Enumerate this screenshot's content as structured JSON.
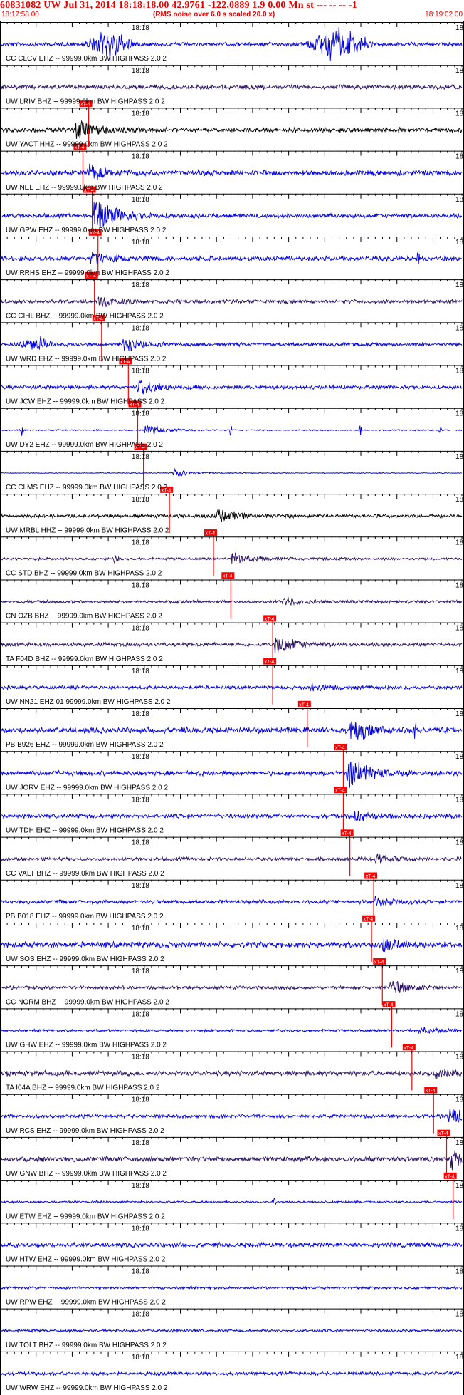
{
  "header": {
    "title": "60831082 UW Jul 31, 2014 18:18:18.00   42.9761 -122.0889  1.9 0.00 Mn st --- -- --   -1",
    "start_time": "18:17:58.00",
    "note": "(RMS noise over 6.0 s scaled 20.0 x)",
    "end_time": "18:19:02.00"
  },
  "colors": {
    "header_text": "#e60000",
    "trace_blue": "#0000dd",
    "trace_navy": "#2a1263",
    "trace_black": "#000000",
    "pick": "#ff0000",
    "grid": "#000000"
  },
  "chart_data": {
    "type": "seismogram",
    "time_window": [
      "18:17:58.00",
      "18:19:02.00"
    ],
    "time_start_s": 0,
    "time_end_s": 64,
    "origin_s": 20,
    "major_tick_label": "18:18",
    "right_edge_label": "18",
    "pick_label": "xT-4",
    "minor_tick_s": 1,
    "major_tick_s": 5,
    "traces": [
      {
        "label": "CC CLCV EHZ -- 99999.0km BW  HIGHPASS  2.0  2",
        "color": "blue",
        "pick_s": null,
        "noise": 0.45,
        "onset_s": null,
        "burst_amp": 0,
        "bursts": [
          {
            "t": 15,
            "d": 4,
            "a": 3.5
          },
          {
            "t": 47,
            "d": 5,
            "a": 4
          }
        ]
      },
      {
        "label": "UW LRIV BHZ -- 99999.0km BW  HIGHPASS  2.0  2",
        "color": "navy",
        "pick_s": 11,
        "noise": 0.5,
        "onset_s": null,
        "burst_amp": 0,
        "bursts": []
      },
      {
        "label": "UW YACT HHZ -- 99999.0km BW  HIGHPASS  2.0  2",
        "color": "black",
        "pick_s": 10.2,
        "noise": 0.55,
        "onset_s": 10.5,
        "burst_amp": 3,
        "bursts": []
      },
      {
        "label": "UW NEL EHZ -- 99999.0km BW  HIGHPASS  2.0  2",
        "color": "blue",
        "pick_s": 11.5,
        "noise": 0.6,
        "onset_s": 12,
        "burst_amp": 2.2,
        "bursts": []
      },
      {
        "label": "UW GPW EHZ -- 99999.0km BW  HIGHPASS  2.0  2",
        "color": "blue",
        "pick_s": 12.3,
        "noise": 0.5,
        "onset_s": 13,
        "burst_amp": 5.5,
        "bursts": []
      },
      {
        "label": "UW RRHS EHZ -- 99999.0km BW  HIGHPASS  2.0  2",
        "color": "blue",
        "pick_s": 11.8,
        "noise": 0.55,
        "onset_s": 12.5,
        "burst_amp": 1.8,
        "bursts": [
          {
            "t": 58,
            "d": 0.3,
            "a": 3
          }
        ]
      },
      {
        "label": "CC CIHL BHZ -- 99999.0km BW  HIGHPASS  2.0  2",
        "color": "navy",
        "pick_s": 12.8,
        "noise": 0.45,
        "onset_s": 13.5,
        "burst_amp": 1.5,
        "bursts": []
      },
      {
        "label": "UW WRD EHZ -- 99999.0km BW  HIGHPASS  2.0  2",
        "color": "blue",
        "pick_s": 16.5,
        "noise": 0.4,
        "onset_s": 17,
        "burst_amp": 2,
        "bursts": [
          {
            "t": 5,
            "d": 3,
            "a": 1.8
          }
        ]
      },
      {
        "label": "UW JCW EHZ -- 99999.0km BW  HIGHPASS  2.0  2",
        "color": "blue",
        "pick_s": 17.8,
        "noise": 0.45,
        "onset_s": 19,
        "burst_amp": 2.5,
        "bursts": []
      },
      {
        "label": "UW DY2 EHZ -- 99999.0km BW  HIGHPASS  2.0  2",
        "color": "blue",
        "pick_s": 18.6,
        "noise": 0.15,
        "onset_s": 20,
        "burst_amp": 1.5,
        "bursts": [
          {
            "t": 3,
            "d": 0.3,
            "a": 2
          },
          {
            "t": 32,
            "d": 0.3,
            "a": 2
          },
          {
            "t": 50,
            "d": 0.3,
            "a": 2
          },
          {
            "t": 61,
            "d": 0.3,
            "a": 1.5
          }
        ]
      },
      {
        "label": "CC CLMS EHZ -- 99999.0km BW  HIGHPASS  2.0  2",
        "color": "blue",
        "pick_s": 22.2,
        "noise": 0.1,
        "onset_s": 24,
        "burst_amp": 1.2,
        "bursts": []
      },
      {
        "label": "UW MRBL HHZ -- 99999.0km BW  HIGHPASS  2.0  2",
        "color": "black",
        "pick_s": 28.3,
        "noise": 0.4,
        "onset_s": 30,
        "burst_amp": 2,
        "bursts": []
      },
      {
        "label": "CC STD BHZ -- 99999.0km BW  HIGHPASS  2.0  2",
        "color": "navy",
        "pick_s": 30.7,
        "noise": 0.3,
        "onset_s": 32,
        "burst_amp": 1.8,
        "bursts": [
          {
            "t": 16,
            "d": 0.6,
            "a": 1.5
          }
        ]
      },
      {
        "label": "CN OZB BHZ -- 99999.0km BW  HIGHPASS  2.0  2",
        "color": "navy",
        "pick_s": 36.5,
        "noise": 0.35,
        "onset_s": 39,
        "burst_amp": 1,
        "bursts": []
      },
      {
        "label": "TA F04D BHZ -- 99999.0km BW  HIGHPASS  2.0  2",
        "color": "navy",
        "pick_s": 36.5,
        "noise": 0.45,
        "onset_s": 38,
        "burst_amp": 3,
        "bursts": []
      },
      {
        "label": "UW NN21 EHZ 01 99999.0km BW  HIGHPASS  2.0  2",
        "color": "blue",
        "pick_s": 41.3,
        "noise": 0.4,
        "onset_s": 43,
        "burst_amp": 1.3,
        "bursts": []
      },
      {
        "label": "PB B926 EHZ -- 99999.0km BW  HIGHPASS  2.0  2",
        "color": "blue",
        "pick_s": 46.3,
        "noise": 0.7,
        "onset_s": 48.5,
        "burst_amp": 3,
        "bursts": [
          {
            "t": 57.5,
            "d": 0.3,
            "a": 4
          }
        ]
      },
      {
        "label": "UW JORV EHZ -- 99999.0km BW  HIGHPASS  2.0  2",
        "color": "blue",
        "pick_s": 46.3,
        "noise": 0.55,
        "onset_s": 48,
        "burst_amp": 5,
        "bursts": []
      },
      {
        "label": "UW TDH EHZ -- 99999.0km BW  HIGHPASS  2.0  2",
        "color": "blue",
        "pick_s": 47.2,
        "noise": 0.5,
        "onset_s": 49,
        "burst_amp": 1.4,
        "bursts": []
      },
      {
        "label": "CC VALT BHZ -- 99999.0km BW  HIGHPASS  2.0  2",
        "color": "navy",
        "pick_s": 50.5,
        "noise": 0.4,
        "onset_s": 52,
        "burst_amp": 1.2,
        "bursts": []
      },
      {
        "label": "PB B018 EHZ -- 99999.0km BW  HIGHPASS  2.0  2",
        "color": "blue",
        "pick_s": 50.2,
        "noise": 0.45,
        "onset_s": 52,
        "burst_amp": 1.2,
        "bursts": []
      },
      {
        "label": "UW SOS EHZ -- 99999.0km BW  HIGHPASS  2.0  2",
        "color": "blue",
        "pick_s": 51.7,
        "noise": 0.7,
        "onset_s": 53,
        "burst_amp": 1.5,
        "bursts": []
      },
      {
        "label": "CC NORM BHZ -- 99999.0km BW  HIGHPASS  2.0  2",
        "color": "navy",
        "pick_s": 53,
        "noise": 0.4,
        "onset_s": 54,
        "burst_amp": 2.2,
        "bursts": []
      },
      {
        "label": "UW GHW EHZ -- 99999.0km BW  HIGHPASS  2.0  2",
        "color": "blue",
        "pick_s": 55.8,
        "noise": 0.3,
        "onset_s": 58,
        "burst_amp": 1,
        "bursts": []
      },
      {
        "label": "TA I04A BHZ -- 99999.0km BW  HIGHPASS  2.0  2",
        "color": "navy",
        "pick_s": 58.8,
        "noise": 0.6,
        "onset_s": 60,
        "burst_amp": 1,
        "bursts": []
      },
      {
        "label": "UW RCS EHZ -- 99999.0km BW  HIGHPASS  2.0  2",
        "color": "blue",
        "pick_s": 60.6,
        "noise": 0.4,
        "onset_s": 62,
        "burst_amp": 2.5,
        "bursts": []
      },
      {
        "label": "UW GNW BHZ -- 99999.0km BW  HIGHPASS  2.0  2",
        "color": "navy",
        "pick_s": 61.5,
        "noise": 0.6,
        "onset_s": 62.5,
        "burst_amp": 2.5,
        "bursts": []
      },
      {
        "label": "UW ETW EHZ -- 99999.0km BW  HIGHPASS  2.0  2",
        "color": "blue",
        "pick_s": null,
        "noise": 0.25,
        "onset_s": null,
        "burst_amp": 0,
        "bursts": [
          {
            "t": 38,
            "d": 0.3,
            "a": 2
          }
        ]
      },
      {
        "label": "UW HTW EHZ -- 99999.0km BW  HIGHPASS  2.0  2",
        "color": "blue",
        "pick_s": null,
        "noise": 0.55,
        "onset_s": null,
        "burst_amp": 0,
        "bursts": []
      },
      {
        "label": "UW RPW EHZ -- 99999.0km BW  HIGHPASS  2.0  2",
        "color": "blue",
        "pick_s": null,
        "noise": 0.3,
        "onset_s": null,
        "burst_amp": 0,
        "bursts": []
      },
      {
        "label": "UW TOLT BHZ -- 99999.0km BW  HIGHPASS  2.0  2",
        "color": "blue",
        "pick_s": null,
        "noise": 0.3,
        "onset_s": null,
        "burst_amp": 0,
        "bursts": []
      },
      {
        "label": "UW WRW EHZ -- 99999.0km BW  HIGHPASS  2.0  2",
        "color": "blue",
        "pick_s": null,
        "noise": 0.4,
        "onset_s": null,
        "burst_amp": 0,
        "bursts": []
      }
    ]
  }
}
